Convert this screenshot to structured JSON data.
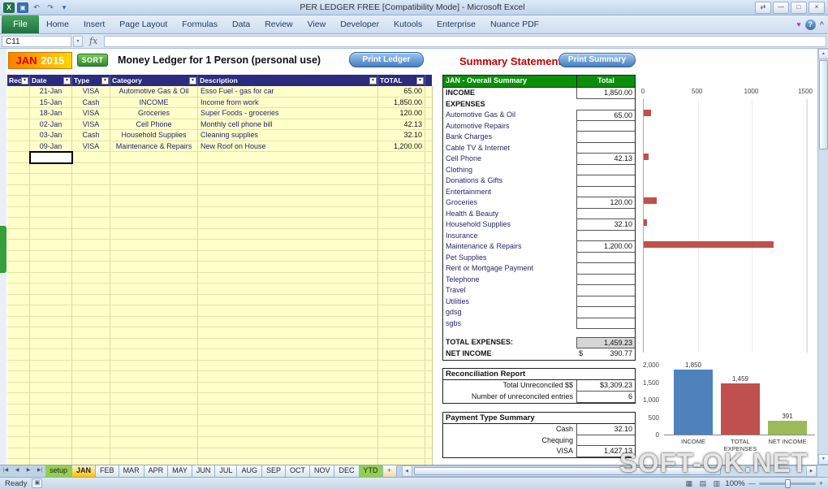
{
  "window": {
    "title": "PER LEDGER FREE  [Compatibility Mode] - Microsoft Excel",
    "name_box": "C11"
  },
  "ribbon": {
    "file_label": "File",
    "tabs": [
      "Home",
      "Insert",
      "Page Layout",
      "Formulas",
      "Data",
      "Review",
      "View",
      "Developer",
      "Kutools",
      "Enterprise",
      "Nuance PDF"
    ]
  },
  "ledger": {
    "month": "JAN",
    "year": "2015",
    "sort_label": "SORT",
    "title": "Money Ledger for 1 Person (personal use)",
    "print_label": "Print Ledger",
    "columns": [
      "Rec",
      "Date",
      "Type",
      "Category",
      "Description",
      "TOTAL"
    ],
    "rows": [
      {
        "date": "21-Jan",
        "type": "VISA",
        "category": "Automotive Gas & Oil",
        "description": "Esso Fuel - gas for car",
        "total": "65.00"
      },
      {
        "date": "15-Jan",
        "type": "Cash",
        "category": "INCOME",
        "description": "Income from work",
        "total": "1,850.00"
      },
      {
        "date": "18-Jan",
        "type": "VISA",
        "category": "Groceries",
        "description": "Super Foods - groceries",
        "total": "120.00"
      },
      {
        "date": "02-Jan",
        "type": "VISA",
        "category": "Cell Phone",
        "description": "Monthly cell phone bill",
        "total": "42.13"
      },
      {
        "date": "03-Jan",
        "type": "Cash",
        "category": "Household Supplies",
        "description": "Cleaning supplies",
        "total": "32.10"
      },
      {
        "date": "09-Jan",
        "type": "VISA",
        "category": "Maintenance & Repairs",
        "description": "New Roof on House",
        "total": "1,200.00"
      }
    ],
    "empty_row_count": 29
  },
  "summary": {
    "title": "Summary Statements",
    "print_label": "Print Summary",
    "header": "JAN - Overall Summary",
    "total_col": "Total",
    "income_label": "INCOME",
    "income_value": "1,850.00",
    "expenses_label": "EXPENSES",
    "expense_rows": [
      {
        "label": "Automotive Gas & Oil",
        "value": "65.00"
      },
      {
        "label": "Automotive Repairs",
        "value": ""
      },
      {
        "label": "Bank Charges",
        "value": ""
      },
      {
        "label": "Cable TV & Internet",
        "value": ""
      },
      {
        "label": "Cell Phone",
        "value": "42.13"
      },
      {
        "label": "Clothing",
        "value": ""
      },
      {
        "label": "Donations & Gifts",
        "value": ""
      },
      {
        "label": "Entertainment",
        "value": ""
      },
      {
        "label": "Groceries",
        "value": "120.00"
      },
      {
        "label": "Health & Beauty",
        "value": ""
      },
      {
        "label": "Household Supplies",
        "value": "32.10"
      },
      {
        "label": "Insurance",
        "value": ""
      },
      {
        "label": "Maintenance & Repairs",
        "value": "1,200.00"
      },
      {
        "label": "Pet Supplies",
        "value": ""
      },
      {
        "label": "Rent or Mortgage Payment",
        "value": ""
      },
      {
        "label": "Telephone",
        "value": ""
      },
      {
        "label": "Travel",
        "value": ""
      },
      {
        "label": "Utilities",
        "value": ""
      },
      {
        "label": "gdsg",
        "value": ""
      },
      {
        "label": "sgbs",
        "value": ""
      }
    ],
    "total_expenses_label": "TOTAL EXPENSES:",
    "total_expenses_value": "1,459.23",
    "net_income_label": "NET INCOME",
    "net_income_currency": "$",
    "net_income_value": "390.77"
  },
  "reconciliation": {
    "title": "Reconciliation Report",
    "rows": [
      {
        "label": "Total Unreconciled $$",
        "value": "$3,309.23"
      },
      {
        "label": "Number of unreconciled entries",
        "value": "6"
      }
    ]
  },
  "payment_summary": {
    "title": "Payment Type Summary",
    "rows": [
      {
        "label": "Cash",
        "value": "32.10"
      },
      {
        "label": "Chequing",
        "value": ""
      },
      {
        "label": "VISA",
        "value": "1,427.13"
      }
    ]
  },
  "chart_data": [
    {
      "type": "bar",
      "orientation": "horizontal",
      "title": "",
      "categories": [
        "Automotive Gas & Oil",
        "Automotive Repairs",
        "Bank Charges",
        "Cable TV & Internet",
        "Cell Phone",
        "Clothing",
        "Donations & Gifts",
        "Entertainment",
        "Groceries",
        "Health & Beauty",
        "Household Supplies",
        "Insurance",
        "Maintenance & Repairs",
        "Pet Supplies",
        "Rent or Mortgage Payment",
        "Telephone",
        "Travel",
        "Utilities",
        "gdsg",
        "sgbs"
      ],
      "values": [
        65,
        0,
        0,
        0,
        42.13,
        0,
        0,
        0,
        120,
        0,
        32.1,
        0,
        1200,
        0,
        0,
        0,
        0,
        0,
        0,
        0
      ],
      "xlim": [
        0,
        1500
      ],
      "x_ticks": [
        "0",
        "500",
        "1000",
        "1500"
      ],
      "bar_color": "#c0504d",
      "grid": false,
      "legend": false
    },
    {
      "type": "bar",
      "orientation": "vertical",
      "title": "",
      "categories": [
        "INCOME",
        "TOTAL EXPENSES",
        "NET INCOME"
      ],
      "values": [
        1850,
        1459,
        391
      ],
      "labels": [
        "1,850",
        "1,459",
        "391"
      ],
      "colors": [
        "#4f81bd",
        "#c0504d",
        "#9bbb59"
      ],
      "ylim": [
        0,
        2000
      ],
      "y_ticks": [
        "2,000",
        "1,500",
        "1,000",
        "500",
        "0"
      ],
      "grid": false,
      "legend": false
    }
  ],
  "sheet_tabs": [
    {
      "label": "setup",
      "color": "#92d050"
    },
    {
      "label": "JAN",
      "active": true
    },
    {
      "label": "FEB"
    },
    {
      "label": "MAR"
    },
    {
      "label": "APR"
    },
    {
      "label": "MAY"
    },
    {
      "label": "JUN"
    },
    {
      "label": "JUL"
    },
    {
      "label": "AUG"
    },
    {
      "label": "SEP"
    },
    {
      "label": "OCT"
    },
    {
      "label": "NOV"
    },
    {
      "label": "DEC"
    },
    {
      "label": "YTD",
      "color": "#92d050"
    }
  ],
  "status_bar": {
    "ready": "Ready",
    "zoom": "100%"
  },
  "watermark": "SOFT-OK.NET",
  "icons": {
    "excel_app": "X",
    "save": "▣",
    "undo": "↶",
    "redo": "↷",
    "qat_dropdown": "▾",
    "resize_arrows": "⇄",
    "minimize": "—",
    "maximize": "□",
    "close": "×",
    "heart": "♥",
    "help": "?",
    "collapse_ribbon": "^",
    "namebox_dropdown": "▼",
    "fx": "fx",
    "filter": "▼",
    "scroll_up": "▲",
    "scroll_down": "▼",
    "scroll_left": "◀",
    "scroll_right": "▶",
    "tab_first": "|◀",
    "tab_prev": "◀",
    "tab_next": "▶",
    "tab_last": "▶|",
    "add_sheet": "+",
    "view_normal": "▦",
    "view_layout": "▤",
    "view_break": "▥",
    "zoom_out": "—",
    "zoom_in": "+",
    "macro_record": "▣"
  }
}
